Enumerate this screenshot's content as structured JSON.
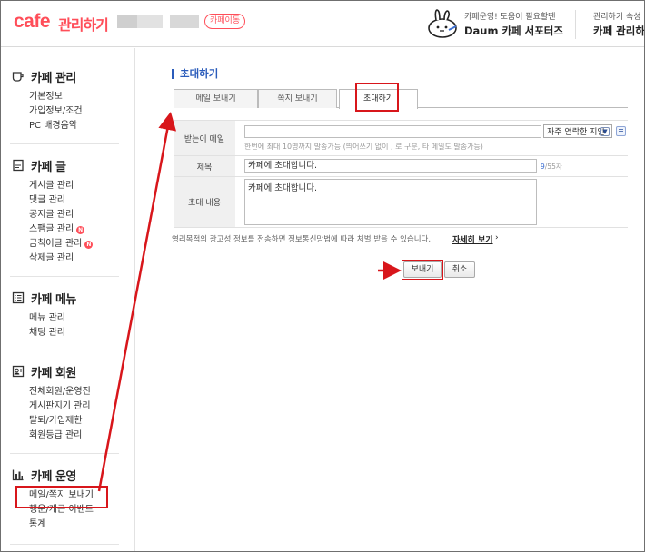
{
  "header": {
    "logo": "cafe",
    "logo_sub": "관리하기",
    "cafe_move_badge": "카페이동",
    "support_small": "카페운영! 도움이 필요할땐",
    "support_big": "Daum 카페 서포터즈",
    "manager_small": "관리하기 속성",
    "manager_big": "카페 관리하",
    "support_icon": "rabbit-icon"
  },
  "sidebar": {
    "sections": [
      {
        "title": "카페 관리",
        "icon": "cup-icon",
        "items": [
          "기본정보",
          "가입정보/조건",
          "PC 배경음악"
        ]
      },
      {
        "title": "카페 글",
        "icon": "document-icon",
        "items": [
          "게시글 관리",
          "댓글 관리",
          "공지글 관리",
          "스팸글 관리",
          "금칙어글 관리",
          "삭제글 관리"
        ]
      },
      {
        "title": "카페 메뉴",
        "icon": "menu-list-icon",
        "items": [
          "메뉴 관리",
          "채팅 관리"
        ]
      },
      {
        "title": "카페 회원",
        "icon": "member-card-icon",
        "items": [
          "전체회원/운영진",
          "게시판지기 관리",
          "탈퇴/가입제한",
          "회원등급 관리"
        ]
      },
      {
        "title": "카페 운영",
        "icon": "bar-chart-icon",
        "items": [
          "메일/쪽지 보내기",
          "행운/개근 이벤트",
          "통계"
        ]
      }
    ],
    "new_badge": "N"
  },
  "main": {
    "title": "초대하기",
    "tabs": [
      {
        "label": "메일 보내기"
      },
      {
        "label": "쪽지 보내기"
      },
      {
        "label": "초대하기"
      }
    ],
    "form": {
      "recipient_label": "받는이 메일",
      "recipient_value": "",
      "contact_select": "자주 연락한 지인",
      "recipient_hint": "한번에 최대 10명까지 발송가능 (띄어쓰기 없이 , 로 구분, 타 메일도 발송가능)",
      "subject_label": "제목",
      "subject_value": "카페에 초대합니다.",
      "subject_count": "9",
      "subject_max": "/55자",
      "body_label": "초대 내용",
      "body_value": "카페에 초대합니다."
    },
    "notice": "영리목적의 광고성 정보를 전송하면 정보통신망법에 따라 처벌 받을 수 있습니다.",
    "notice_link": "자세히 보기",
    "send_label": "보내기",
    "cancel_label": "취소"
  },
  "colors": {
    "brand": "#ff4e59",
    "title_blue": "#2b5cbb",
    "annotation_red": "#d8161b"
  }
}
